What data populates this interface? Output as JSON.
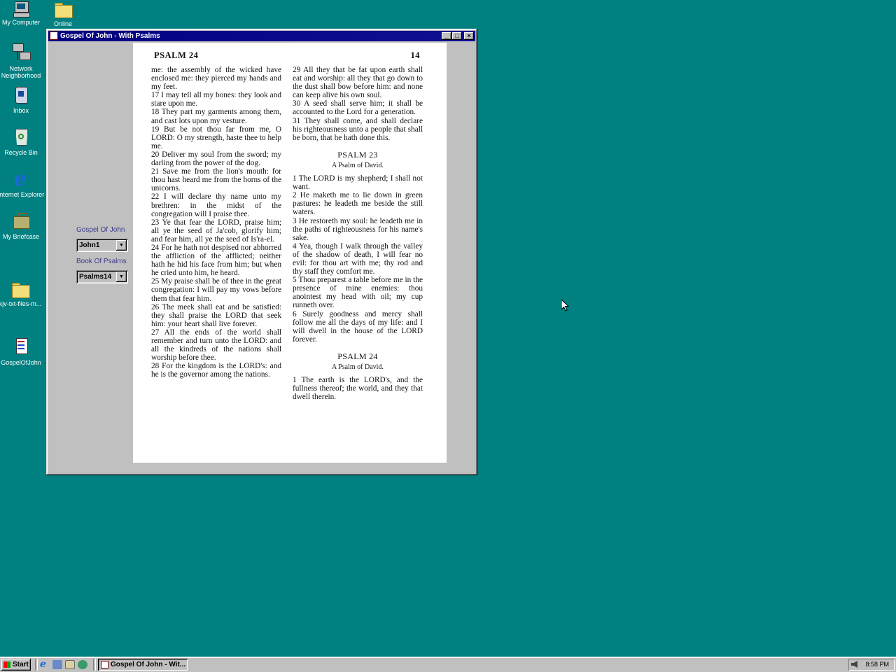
{
  "desktop": {
    "icons": [
      {
        "label": "My Computer",
        "icon": "computer-icon"
      },
      {
        "label": "Online",
        "icon": "folder-icon"
      },
      {
        "label": "Network Neighborhood",
        "icon": "network-icon"
      },
      {
        "label": "Inbox",
        "icon": "inbox-icon"
      },
      {
        "label": "Recycle Bin",
        "icon": "recycle-bin-icon"
      },
      {
        "label": "Internet Explorer",
        "icon": "internet-explorer-icon"
      },
      {
        "label": "My Briefcase",
        "icon": "briefcase-icon"
      },
      {
        "label": "kjv-txt-files-m...",
        "icon": "folder-icon"
      },
      {
        "label": "GospelOfJohn",
        "icon": "document-icon"
      }
    ]
  },
  "window": {
    "title": "Gospel Of John - With Psalms",
    "buttons": {
      "minimize": "_",
      "maximize": "□",
      "close": "×"
    },
    "panel": {
      "gospel_label": "Gospel Of John",
      "gospel_value": "John1",
      "psalms_label": "Book Of Psalms",
      "psalms_value": "Psalms14"
    }
  },
  "page": {
    "header_left": "PSALM 24",
    "header_right": "14",
    "left_column": [
      "me: the assembly of the wicked have enclosed me: they pierced my hands and my feet.",
      "17 I may tell all my bones: they look and stare upon me.",
      "18 They part my garments among them, and cast lots upon my vesture.",
      "19 But be not thou far from me, O LORD: O my strength, haste thee to help me.",
      "20 Deliver my soul from the sword; my darling from the power of the dog.",
      "21 Save me from the lion's mouth: for thou hast heard me from the horns of the unicorns.",
      "22 I will declare thy name unto my brethren: in the midst of the congregation will I praise thee.",
      "23 Ye that fear the LORD, praise him; all ye the seed of Ja'cob, glorify him; and fear him, all ye the seed of Is'ra-el.",
      "24 For he hath not despised nor abhorred the affliction of the afflicted; neither hath he hid his face from him; but when he cried unto him, he heard.",
      "25 My praise shall be of thee in the great congregation: I will pay my vows before them that fear him.",
      "26 The meek shall eat and be satisfied: they shall praise the LORD that seek him: your heart shall live forever.",
      "27 All the ends of the world shall remember and turn unto the LORD: and all the kindreds of the nations shall worship before thee.",
      "28 For the kingdom is the LORD's: and he is the governor among the nations."
    ],
    "right_column_top": [
      "29 All they that be fat upon earth shall eat and worship: all they that go down to the dust shall bow before him: and none can keep alive his own soul.",
      "30 A seed shall serve him; it shall be accounted to the Lord for a generation.",
      "31 They shall come, and shall declare his righteousness unto a people that shall be born, that he hath done this."
    ],
    "psalm23_heading": "PSALM 23",
    "psalm23_sub": "A Psalm of David.",
    "psalm23_verses": [
      "1 The LORD is my shepherd; I shall not want.",
      "2 He maketh me to lie down in green pastures: he leadeth me beside the still waters.",
      "3 He restoreth my soul: he leadeth me in the paths of righteousness for his name's sake.",
      "4 Yea, though I walk through the valley of the shadow of death, I will fear no evil: for thou art with me; thy rod and thy staff they comfort me.",
      "5 Thou preparest a table before me in the presence of mine enemies: thou anointest my head with oil; my cup runneth over.",
      "6 Surely goodness and mercy shall follow me all the days of my life: and I will dwell in the house of the LORD forever."
    ],
    "psalm24_heading": "PSALM 24",
    "psalm24_sub": "A Psalm of David.",
    "psalm24_verses": [
      "1 The earth is the LORD's, and the fullness thereof; the world, and they that dwell therein."
    ]
  },
  "taskbar": {
    "start_label": "Start",
    "task_label": "Gospel Of John - Wit...",
    "clock": "8:58 PM"
  },
  "colors": {
    "desktop": "#008080",
    "titlebar": "#000080",
    "panel_label": "#3a3a8c"
  }
}
